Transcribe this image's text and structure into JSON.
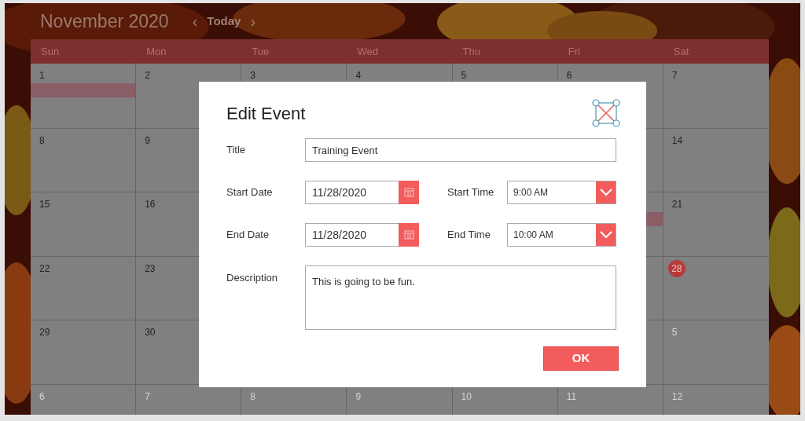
{
  "header": {
    "month": "November 2020",
    "prev": "‹",
    "today": "Today",
    "next": "›"
  },
  "weekdays": [
    "Sun",
    "Mon",
    "Tue",
    "Wed",
    "Thu",
    "Fri",
    "Sat"
  ],
  "weeks": [
    {
      "sun": {
        "day": "1",
        "other_month": false,
        "selected": false,
        "event": true
      },
      "mon": {
        "day": "2",
        "other_month": false,
        "selected": false,
        "event": false
      },
      "tue": {
        "day": "3",
        "other_month": false,
        "selected": false
      },
      "wed": {
        "day": "4",
        "other_month": false,
        "selected": false
      },
      "thu": {
        "day": "5",
        "other_month": false,
        "selected": false
      },
      "fri": {
        "day": "6",
        "other_month": false,
        "selected": false,
        "event": false
      },
      "sat": {
        "day": "7",
        "other_month": false,
        "selected": false,
        "event": false
      }
    },
    {
      "sun": {
        "day": "8",
        "other_month": false,
        "selected": false,
        "event": false
      },
      "mon": {
        "day": "9",
        "other_month": false,
        "selected": false,
        "event": false
      },
      "fri": {
        "event": false
      },
      "sat": {
        "day": "14",
        "other_month": false,
        "selected": false,
        "event": false
      }
    },
    {
      "sun": {
        "day": "15",
        "other_month": false,
        "selected": false,
        "event": false
      },
      "mon": {
        "day": "16",
        "other_month": false,
        "selected": false,
        "event": false
      },
      "fri": {
        "event": true
      },
      "sat": {
        "day": "21",
        "other_month": false,
        "selected": false,
        "event": false
      }
    },
    {
      "sun": {
        "day": "22",
        "other_month": false,
        "selected": false,
        "event": false
      },
      "mon": {
        "day": "23",
        "other_month": false,
        "selected": false,
        "event": false
      },
      "fri": {
        "event": false
      },
      "sat": {
        "day": "28",
        "other_month": false,
        "selected": true,
        "event": false
      }
    },
    {
      "sun": {
        "day": "29",
        "other_month": false,
        "selected": false,
        "event": false
      },
      "mon": {
        "day": "30",
        "other_month": false,
        "selected": false,
        "event": false
      },
      "fri": {
        "event": false
      },
      "sat": {
        "day": "5",
        "other_month": true,
        "selected": false,
        "event": false
      }
    },
    {
      "sun": {
        "day": "6",
        "other_month": true,
        "selected": false,
        "event": false
      },
      "mon": {
        "day": "7",
        "other_month": true,
        "selected": false,
        "event": false
      },
      "tue": {
        "day": "8",
        "other_month": true,
        "selected": false,
        "event": false
      },
      "wed": {
        "day": "9",
        "other_month": true,
        "selected": false,
        "event": false
      },
      "thu": {
        "day": "10",
        "other_month": true,
        "selected": false,
        "event": false
      },
      "fri": {
        "day": "11",
        "other_month": true,
        "selected": false,
        "event": false
      },
      "sat": {
        "day": "12",
        "other_month": true,
        "selected": false,
        "event": false
      }
    }
  ],
  "dialog": {
    "title": "Edit Event",
    "title_label": "Title",
    "title_value": "Training Event",
    "start_date_label": "Start Date",
    "start_date": "11/28/2020",
    "start_time_label": "Start Time",
    "start_time": "9:00 AM",
    "end_date_label": "End Date",
    "end_date": "11/28/2020",
    "end_time_label": "End Time",
    "end_time": "10:00 AM",
    "description_label": "Description",
    "description": "This is going to be fun.",
    "ok": "OK"
  }
}
